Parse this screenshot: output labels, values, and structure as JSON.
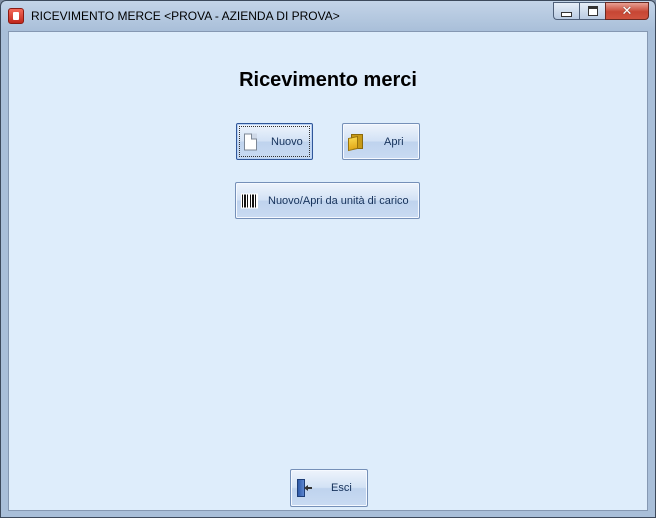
{
  "window": {
    "title": "RICEVIMENTO MERCE <PROVA - AZIENDA DI PROVA>",
    "caption_buttons": {
      "minimize": "minimize-icon",
      "maximize": "maximize-icon",
      "close": "close-icon"
    }
  },
  "main": {
    "heading": "Ricevimento merci",
    "buttons": {
      "nuovo": {
        "label": "Nuovo",
        "icon": "document-icon"
      },
      "apri": {
        "label": "Apri",
        "icon": "folder-icon"
      },
      "nuovo_apri_udc": {
        "label": "Nuovo/Apri da unità di carico",
        "icon": "barcode-icon"
      },
      "esci": {
        "label": "Esci",
        "icon": "exit-door-icon"
      }
    }
  },
  "colors": {
    "client_background": "#deedfb",
    "button_text": "#15315a",
    "close_button": "#c74634"
  }
}
